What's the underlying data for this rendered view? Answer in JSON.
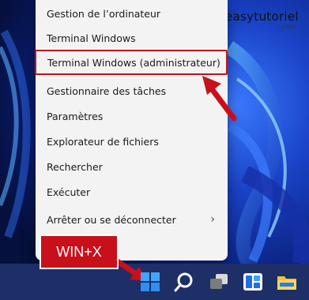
{
  "menu": {
    "items": [
      {
        "label": "Gestion de l’ordinateur"
      },
      {
        "label": "Terminal Windows"
      },
      {
        "label": "Terminal Windows (administrateur)"
      },
      {
        "label": "Gestionnaire des tâches"
      },
      {
        "label": "Paramètres"
      },
      {
        "label": "Explorateur de fichiers"
      },
      {
        "label": "Rechercher"
      },
      {
        "label": "Exécuter"
      },
      {
        "label": "Arrêter ou se déconnecter"
      }
    ],
    "submenu_chevron": "›"
  },
  "annotation": {
    "shortcut_label": "WIN+X",
    "highlight_color": "#c0141d"
  },
  "watermark": {
    "name": "easytutoriel",
    "domain": ".com"
  },
  "taskbar": {
    "icons": [
      "windows-start-icon",
      "search-icon",
      "task-view-icon",
      "widgets-icon",
      "file-explorer-icon"
    ]
  }
}
